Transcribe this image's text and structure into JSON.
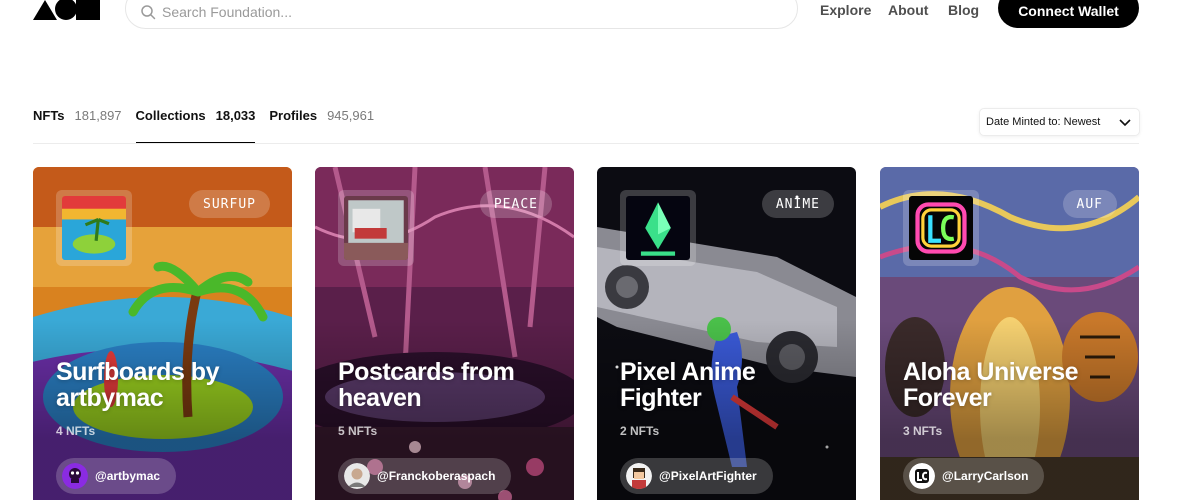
{
  "header": {
    "search_placeholder": "Search Foundation...",
    "nav": [
      "Explore",
      "About",
      "Blog"
    ],
    "connect_label": "Connect Wallet"
  },
  "tabs": [
    {
      "label": "NFTs",
      "count": "181,897",
      "active": false
    },
    {
      "label": "Collections",
      "count": "18,033",
      "active": true
    },
    {
      "label": "Profiles",
      "count": "945,961",
      "active": false
    }
  ],
  "sort": {
    "selected": "Date Minted to: Newest"
  },
  "cards": [
    {
      "tag": "SURFUP",
      "title": "Surfboards by artbymac",
      "count": "4 NFTs",
      "creator": "@artbymac"
    },
    {
      "tag": "PEACE",
      "title": "Postcards from heaven",
      "count": "5 NFTs",
      "creator": "@Franckoberaspach"
    },
    {
      "tag": "ANIME",
      "title": "Pixel Anime Fighter",
      "count": "2 NFTs",
      "creator": "@PixelArtFighter"
    },
    {
      "tag": "AUF",
      "title": "Aloha Universe Forever",
      "count": "3 NFTs",
      "creator": "@LarryCarlson"
    }
  ],
  "colors": {
    "accent": "#000000",
    "muted": "#7a7a7a"
  }
}
